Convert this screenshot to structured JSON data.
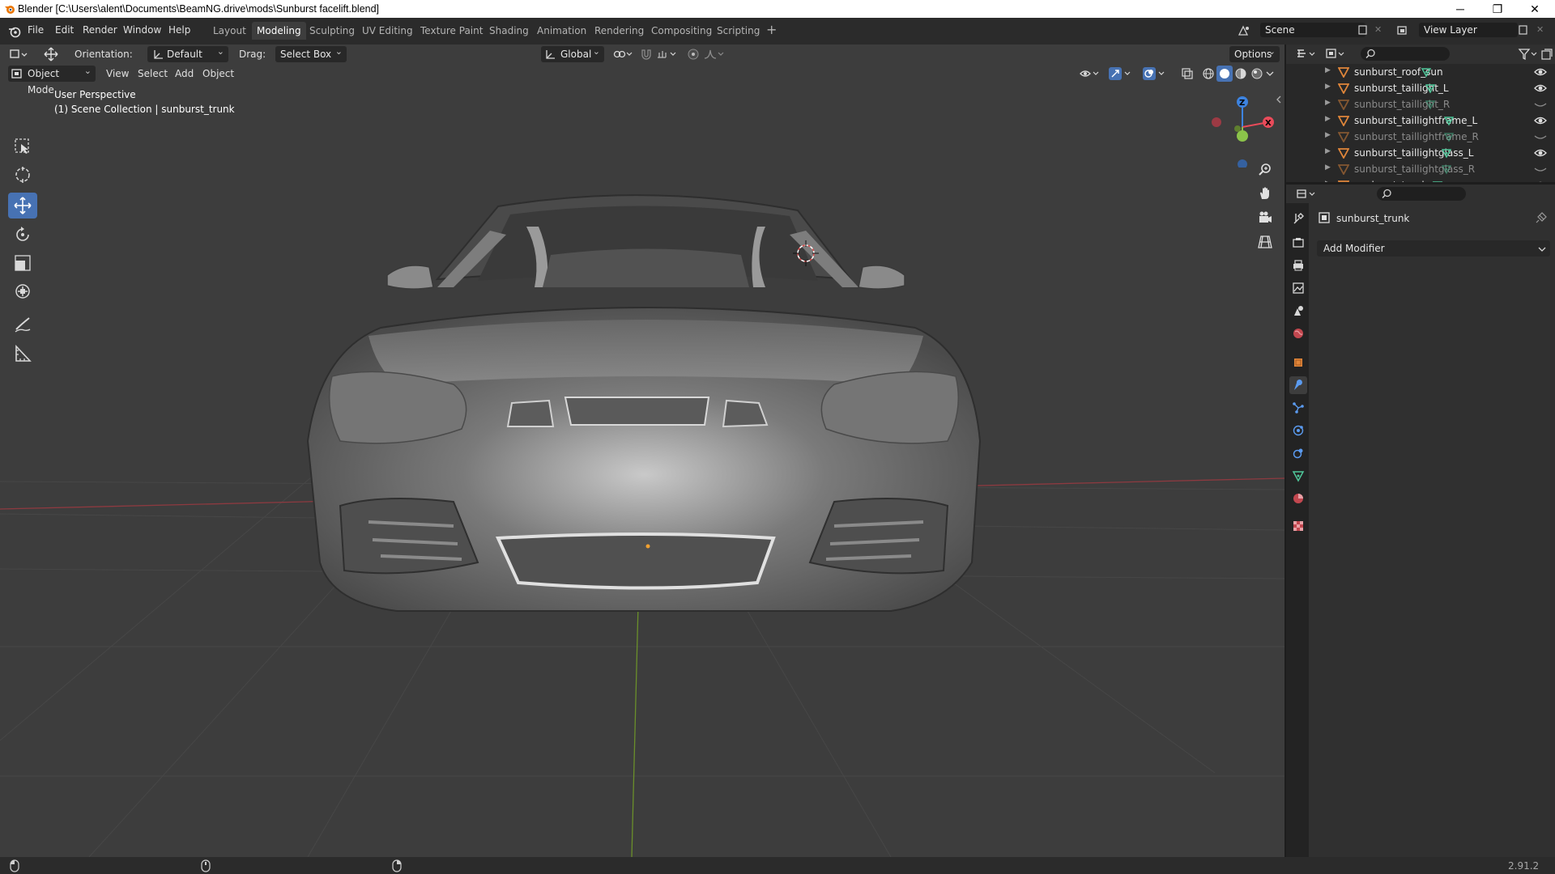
{
  "window": {
    "title": "Blender [C:\\Users\\alent\\Documents\\BeamNG.drive\\mods\\Sunburst facelift.blend]",
    "minimize": "─",
    "maximize": "❐",
    "close": "✕"
  },
  "menu": [
    "File",
    "Edit",
    "Render",
    "Window",
    "Help"
  ],
  "workspaces": {
    "tabs": [
      "Layout",
      "Modeling",
      "Sculpting",
      "UV Editing",
      "Texture Paint",
      "Shading",
      "Animation",
      "Rendering",
      "Compositing",
      "Scripting"
    ],
    "active": "Modeling",
    "add": "+"
  },
  "scene": {
    "name": "Scene"
  },
  "view_layer": {
    "name": "View Layer"
  },
  "tool_header": {
    "orientation_label": "Orientation:",
    "orientation_value": "Default",
    "drag_label": "Drag:",
    "drag_value": "Select Box",
    "transform_orientation": "Global",
    "options": "Options"
  },
  "viewport_header": {
    "mode": "Object Mode",
    "menus": [
      "View",
      "Select",
      "Add",
      "Object"
    ]
  },
  "viewport": {
    "perspective": "User Perspective",
    "collection_info": "(1) Scene Collection | sunburst_trunk",
    "gizmo": {
      "z": "Z",
      "x": "X"
    }
  },
  "outliner": {
    "items": [
      {
        "name": "sunburst_roof_sun",
        "visible": true
      },
      {
        "name": "sunburst_taillight_L",
        "visible": true
      },
      {
        "name": "sunburst_taillight_R",
        "visible": false
      },
      {
        "name": "sunburst_taillightframe_L",
        "visible": true
      },
      {
        "name": "sunburst_taillightframe_R",
        "visible": false
      },
      {
        "name": "sunburst_taillightglass_L",
        "visible": true
      },
      {
        "name": "sunburst_taillightglass_R",
        "visible": false
      },
      {
        "name": "sunburst_trunk",
        "visible": true
      }
    ]
  },
  "properties": {
    "object_name": "sunburst_trunk",
    "add_modifier": "Add Modifier"
  },
  "status": {
    "version": "2.91.2"
  },
  "colors": {
    "accent": "#4772b3",
    "x_axis": "#e84b5a",
    "y_axis": "#8bc34a",
    "z_axis": "#3d83e0",
    "object_orange": "#e0863a",
    "mesh_green": "#4fc79a"
  }
}
